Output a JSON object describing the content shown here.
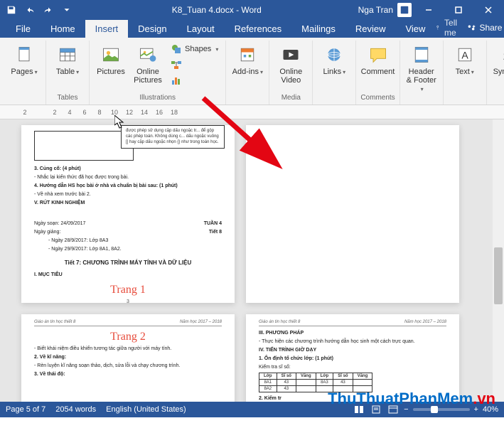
{
  "title": "K8_Tuan 4.docx - Word",
  "user": "Nga Tran",
  "tabs": {
    "file": "File",
    "home": "Home",
    "insert": "Insert",
    "design": "Design",
    "layout": "Layout",
    "references": "References",
    "mailings": "Mailings",
    "review": "Review",
    "view": "View",
    "tellme": "Tell me",
    "share": "Share"
  },
  "ribbon": {
    "pages": {
      "label": "Pages",
      "btn": "Pages"
    },
    "tables": {
      "label": "Tables",
      "btn": "Table"
    },
    "illustrations": {
      "label": "Illustrations",
      "pictures": "Pictures",
      "online_pictures": "Online Pictures",
      "shapes": "Shapes",
      "smartart": "",
      "chart": "",
      "screenshot": ""
    },
    "addins": {
      "label": "",
      "btn": "Add-ins"
    },
    "media": {
      "label": "Media",
      "btn": "Online Video"
    },
    "links": {
      "label": "",
      "btn": "Links"
    },
    "comments": {
      "label": "Comments",
      "btn": "Comment"
    },
    "headerfooter": {
      "label": "",
      "btn": "Header & Footer"
    },
    "text": {
      "label": "",
      "btn": "Text"
    },
    "symbols": {
      "label": "",
      "btn": "Symbols"
    }
  },
  "ruler": [
    "2",
    "",
    "2",
    "4",
    "6",
    "8",
    "10",
    "12",
    "14",
    "16",
    "18"
  ],
  "doc": {
    "float_box": "được phép sử dụng cặp dấu ngoặc tr... để gộp các phép toán. Không dùng c... dấu ngoặc vuông [] hay cặp dấu ngoặc nhọn {} như trong toán học.",
    "p1": {
      "l1": "3. Củng cố: (4 phút)",
      "l2": "- Nhắc lại kiến thức đã học được trong bài.",
      "l3": "4. Hướng dẫn HS học bài ở nhà và chuẩn bị bài sau: (1 phút)",
      "l4": "- Về nhà xem trước bài 2.",
      "l5": "V. RÚT KINH NGHIỆM",
      "date1": "Ngày soạn: 24/09/2017",
      "week": "TUẦN 4",
      "tiet": "Tiết 8",
      "date2": "Ngày giảng:",
      "sched1": "- Ngày 28/9/2017: Lớp 8A3",
      "sched2": "- Ngày 29/9/2017: Lớp 8A1, 8A2.",
      "title": "Tiết 7: CHƯƠNG TRÌNH MÁY TÍNH VÀ DỮ LIỆU",
      "muctieu": "I. MỤC TIÊU",
      "red": "Trang 1",
      "num": "3"
    },
    "p2": {
      "header_l": "Giáo án tin học thiết 8",
      "header_r": "Năm học 2017 – 2018",
      "red": "Trang 2",
      "l1": "- Biết khái niệm điều khiển tương tác giữa người với máy tính.",
      "l2": "2. Về kĩ năng:",
      "l3": "- Rèn luyện kĩ năng soạn thảo, dịch, sửa lỗi và chạy chương trình.",
      "l4": "3. Về thái độ:"
    },
    "p3": {
      "header_l": "Giáo án tin học thiết 8",
      "header_r": "Năm học 2017 – 2018",
      "l1": "III. PHƯƠNG PHÁP",
      "l2": "- Thực hiện các chương trình hướng dẫn học sinh một cách trực quan.",
      "l3": "IV. TIẾN TRÌNH GIỜ DẠY",
      "l4": "1. Ổn định tổ chức lớp: (1 phút)",
      "l5": "Kiểm tra sĩ số:",
      "table": {
        "h1": "Lớp",
        "h2": "Sĩ số",
        "h3": "Vắng",
        "h4": "Lớp",
        "h5": "Sĩ số",
        "h6": "Vắng",
        "r1c1": "8A1",
        "r1c2": "43",
        "r1c3": "",
        "r1c4": "8A3",
        "r1c5": "43",
        "r1c6": "",
        "r2c1": "8A2",
        "r2c2": "43",
        "r2c3": "",
        "r2c4": "",
        "r2c5": "",
        "r2c6": ""
      },
      "l6": "2. Kiểm tr"
    }
  },
  "status": {
    "page": "Page 5 of 7",
    "words": "2054 words",
    "lang": "English (United States)",
    "zoom": "40%"
  },
  "watermark": {
    "main": "ThuThuatPhanMem",
    "ext": ".vn"
  }
}
